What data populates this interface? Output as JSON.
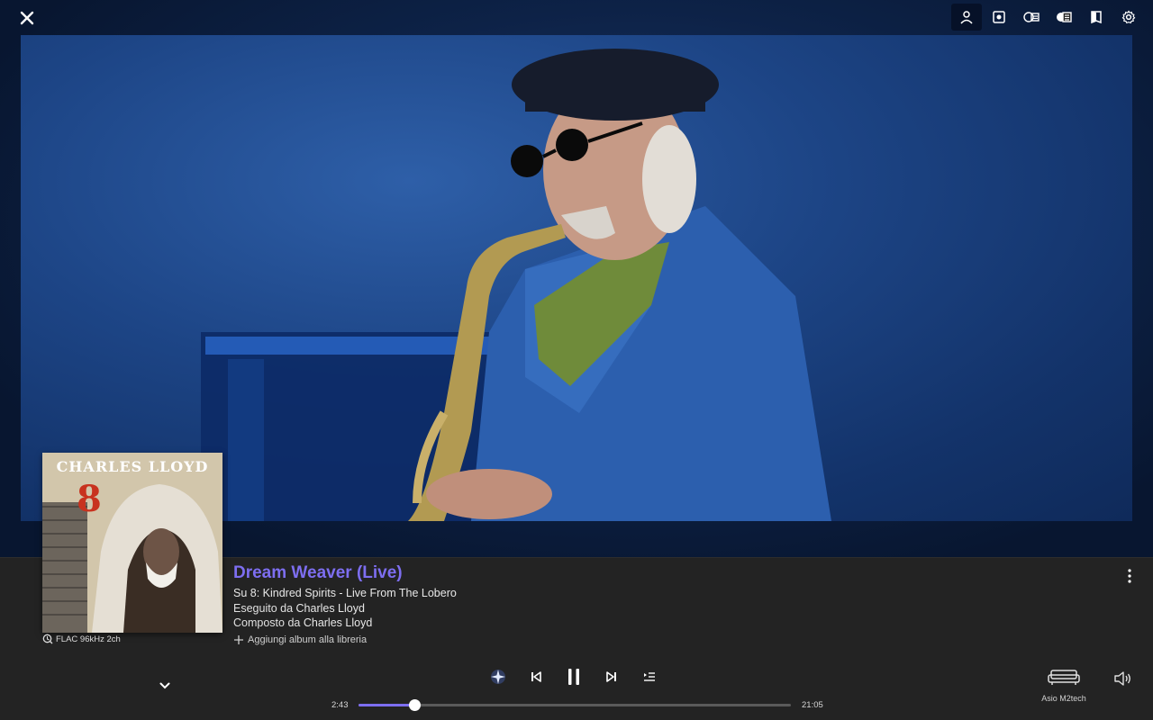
{
  "track": {
    "title": "Dream Weaver (Live)",
    "album_line": "Su 8: Kindred Spirits - Live From The Lobero",
    "performed_label": "Eseguito da",
    "performed_by": "Charles Lloyd",
    "composed_label": "Composto da",
    "composed_by": "Charles Lloyd",
    "add_album": "Aggiungi album alla libreria",
    "quality": "FLAC 96kHz 2ch"
  },
  "cover": {
    "artist_text": "CHARLES LLOYD",
    "number_text": "8"
  },
  "playback": {
    "elapsed": "2:43",
    "duration": "21:05",
    "progress": 0.13
  },
  "output": {
    "device": "Asio M2tech"
  },
  "toolbar": {
    "icons": [
      "artist-icon",
      "album-icon",
      "credits-icon",
      "lyrics-icon",
      "book-icon",
      "gear-icon"
    ]
  },
  "colors": {
    "accent": "#7d6ef0",
    "panel": "#232323",
    "backdrop": "#0b1a33"
  }
}
